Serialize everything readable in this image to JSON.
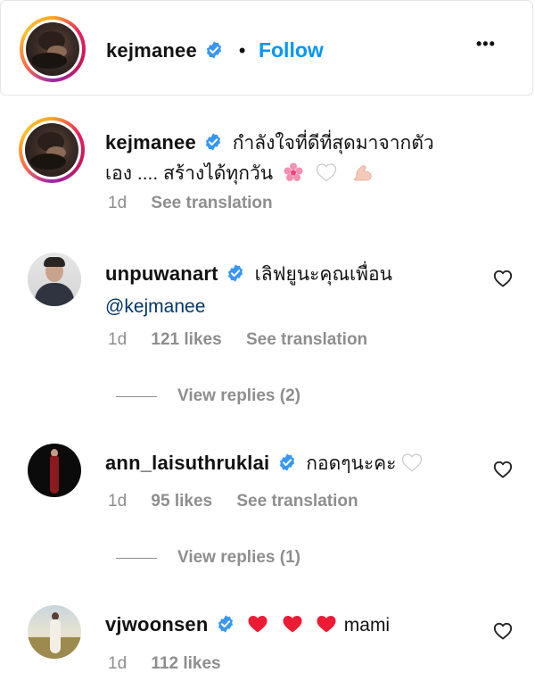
{
  "header": {
    "username": "kejmanee",
    "separator": "•",
    "follow_label": "Follow",
    "more_label": "•••"
  },
  "caption": {
    "username": "kejmanee",
    "text_line1": "กำลังใจที่ดีที่สุดมาจากตัว",
    "text_line2": "เอง .... สร้างได้ทุกวัน",
    "time": "1d",
    "see_translation": "See translation"
  },
  "comments": [
    {
      "username": "unpuwanart",
      "text_line1": "เลิฟยูนะคุณเพื่อน",
      "mention": "@kejmanee",
      "time": "1d",
      "likes": "121 likes",
      "see_translation": "See translation",
      "view_replies": "View replies (2)"
    },
    {
      "username": "ann_laisuthruklai",
      "text_line1": "กอดๆนะคะ",
      "time": "1d",
      "likes": "95 likes",
      "see_translation": "See translation",
      "view_replies": "View replies (1)"
    },
    {
      "username": "vjwoonsen",
      "text_line1": "mami",
      "time": "1d",
      "likes": "112 likes"
    }
  ],
  "colors": {
    "accent": "#0095f6",
    "verified": "#3897f0",
    "muted": "#8e8e8e",
    "heart_red": "#ed1c35"
  }
}
